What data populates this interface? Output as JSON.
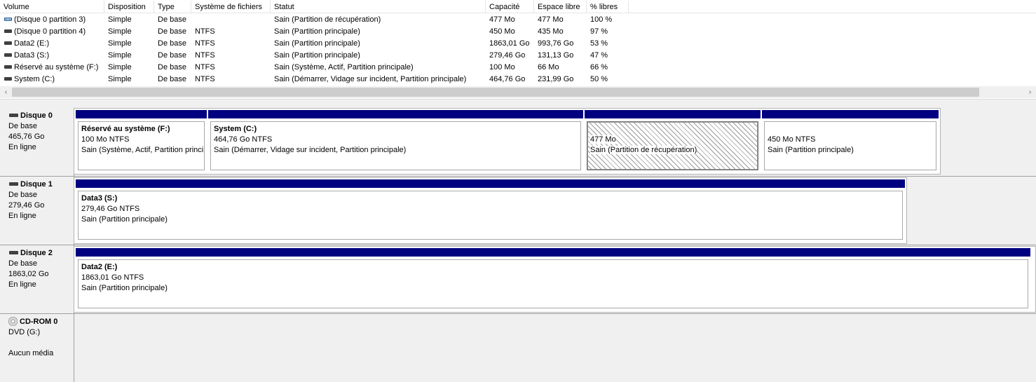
{
  "list": {
    "headers": [
      "Volume",
      "Disposition",
      "Type",
      "Système de fichiers",
      "Statut",
      "Capacité",
      "Espace libre",
      "% libres"
    ],
    "rows": [
      {
        "volume": "(Disque 0 partition 3)",
        "disposition": "Simple",
        "type": "De base",
        "fs": "",
        "status": "Sain (Partition de récupération)",
        "capacity": "477 Mo",
        "free": "477 Mo",
        "pct": "100 %",
        "icon": "recovery-volume-icon"
      },
      {
        "volume": "(Disque 0 partition 4)",
        "disposition": "Simple",
        "type": "De base",
        "fs": "NTFS",
        "status": "Sain (Partition principale)",
        "capacity": "450 Mo",
        "free": "435 Mo",
        "pct": "97 %",
        "icon": "volume-icon"
      },
      {
        "volume": "Data2 (E:)",
        "disposition": "Simple",
        "type": "De base",
        "fs": "NTFS",
        "status": "Sain (Partition principale)",
        "capacity": "1863,01 Go",
        "free": "993,76 Go",
        "pct": "53 %",
        "icon": "volume-icon"
      },
      {
        "volume": "Data3 (S:)",
        "disposition": "Simple",
        "type": "De base",
        "fs": "NTFS",
        "status": "Sain (Partition principale)",
        "capacity": "279,46 Go",
        "free": "131,13 Go",
        "pct": "47 %",
        "icon": "volume-icon"
      },
      {
        "volume": "Réservé au système (F:)",
        "disposition": "Simple",
        "type": "De base",
        "fs": "NTFS",
        "status": "Sain (Système, Actif, Partition principale)",
        "capacity": "100 Mo",
        "free": "66 Mo",
        "pct": "66 %",
        "icon": "volume-icon"
      },
      {
        "volume": "System (C:)",
        "disposition": "Simple",
        "type": "De base",
        "fs": "NTFS",
        "status": "Sain (Démarrer, Vidage sur incident, Partition principale)",
        "capacity": "464,76 Go",
        "free": "231,99 Go",
        "pct": "50 %",
        "icon": "volume-icon"
      }
    ],
    "scroll": {
      "left_arrow": "‹",
      "right_arrow": "›"
    }
  },
  "disks": [
    {
      "name": "Disque 0",
      "kind": "De base",
      "size": "465,76 Go",
      "state": "En ligne",
      "partitions": [
        {
          "name": "Réservé au système  (F:)",
          "size": "100 Mo NTFS",
          "status": "Sain (Système, Actif, Partition principale)"
        },
        {
          "name": "System  (C:)",
          "size": "464,76 Go NTFS",
          "status": "Sain (Démarrer, Vidage sur incident, Partition principale)"
        },
        {
          "name": "",
          "size": "477 Mo",
          "status": "Sain (Partition de récupération)"
        },
        {
          "name": "",
          "size": "450 Mo NTFS",
          "status": "Sain (Partition principale)"
        }
      ]
    },
    {
      "name": "Disque 1",
      "kind": "De base",
      "size": "279,46 Go",
      "state": "En ligne",
      "partitions": [
        {
          "name": "Data3  (S:)",
          "size": "279,46 Go NTFS",
          "status": "Sain (Partition principale)"
        }
      ]
    },
    {
      "name": "Disque 2",
      "kind": "De base",
      "size": "1863,02 Go",
      "state": "En ligne",
      "partitions": [
        {
          "name": "Data2  (E:)",
          "size": "1863,01 Go NTFS",
          "status": "Sain (Partition principale)"
        }
      ]
    }
  ],
  "cdrom": {
    "name": "CD-ROM 0",
    "drive": "DVD (G:)",
    "media": "Aucun média"
  },
  "colors": {
    "partition_bar": "#000080",
    "panel_bg": "#f0f0f0"
  }
}
